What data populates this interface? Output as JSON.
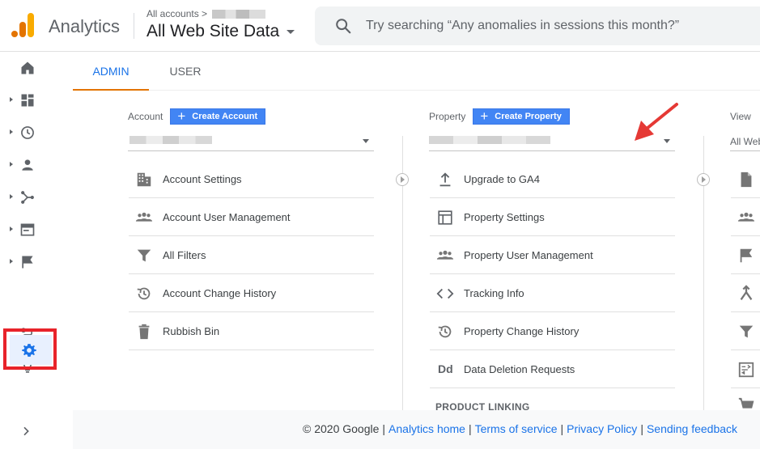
{
  "header": {
    "app_name": "Analytics",
    "breadcrumb": "All accounts >",
    "property_name": "All Web Site Data",
    "search_placeholder": "Try searching “Any anomalies in sessions this month?”"
  },
  "tabs": [
    {
      "label": "ADMIN",
      "active": true
    },
    {
      "label": "USER",
      "active": false
    }
  ],
  "account": {
    "label": "Account",
    "create_label": "Create Account",
    "items": [
      {
        "icon": "building-icon",
        "label": "Account Settings"
      },
      {
        "icon": "people-icon",
        "label": "Account User Management"
      },
      {
        "icon": "filter-icon",
        "label": "All Filters"
      },
      {
        "icon": "history-icon",
        "label": "Account Change History"
      },
      {
        "icon": "trash-icon",
        "label": "Rubbish Bin"
      }
    ]
  },
  "property": {
    "label": "Property",
    "create_label": "Create Property",
    "items": [
      {
        "icon": "upload-icon",
        "label": "Upgrade to GA4"
      },
      {
        "icon": "layout-icon",
        "label": "Property Settings"
      },
      {
        "icon": "people-icon",
        "label": "Property User Management"
      },
      {
        "icon": "code-icon",
        "label": "Tracking Info"
      },
      {
        "icon": "history-icon",
        "label": "Property Change History"
      },
      {
        "icon": "dd-icon",
        "label": "Data Deletion Requests",
        "glyph": "Dd"
      }
    ],
    "section": "PRODUCT LINKING"
  },
  "view": {
    "label": "View",
    "selected": "All Web"
  },
  "footer": {
    "copyright": "© 2020 Google",
    "links": [
      "Analytics home",
      "Terms of service",
      "Privacy Policy",
      "Sending feedback"
    ]
  },
  "colors": {
    "accent": "#1a73e8",
    "tab_underline": "#e37400",
    "button": "#4285f4",
    "highlight_box": "#e8232a",
    "arrow": "#e53935"
  }
}
